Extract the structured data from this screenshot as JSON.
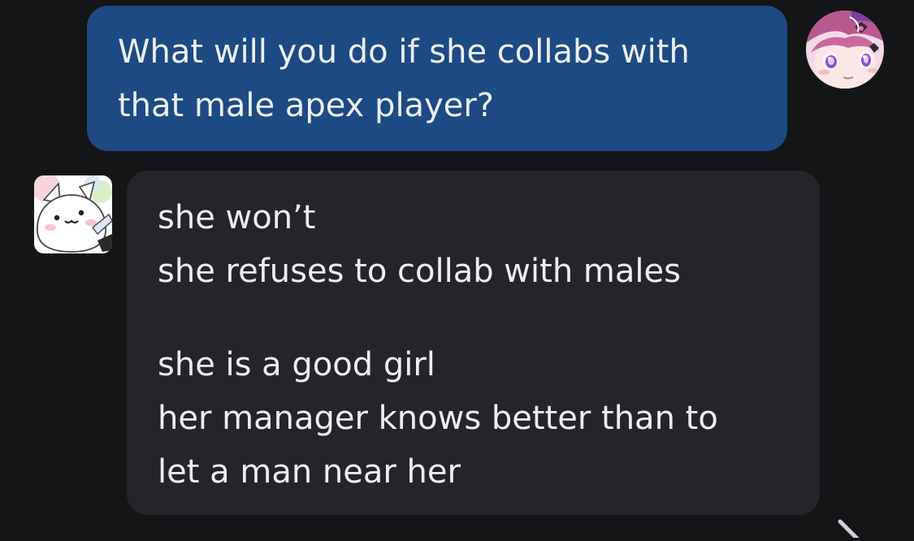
{
  "conversation": {
    "sent_message": {
      "lines": [
        "What will you do if she collabs with",
        "that male apex player?"
      ],
      "color": "#1d4a83"
    },
    "received_message": {
      "paragraphs": [
        [
          "she won’t",
          "she refuses to collab with males"
        ],
        [
          "she is a good girl",
          "her manager knows better than to",
          "let a man near her"
        ]
      ],
      "color": "#232528"
    },
    "avatars": {
      "self": "anime-girl-avatar-icon",
      "other": "white-cat-cartoon-avatar-icon"
    }
  },
  "theme": {
    "background": "#141517",
    "text": "#eceef0"
  },
  "controls": {
    "scroll_indicator": "chevron-icon"
  }
}
